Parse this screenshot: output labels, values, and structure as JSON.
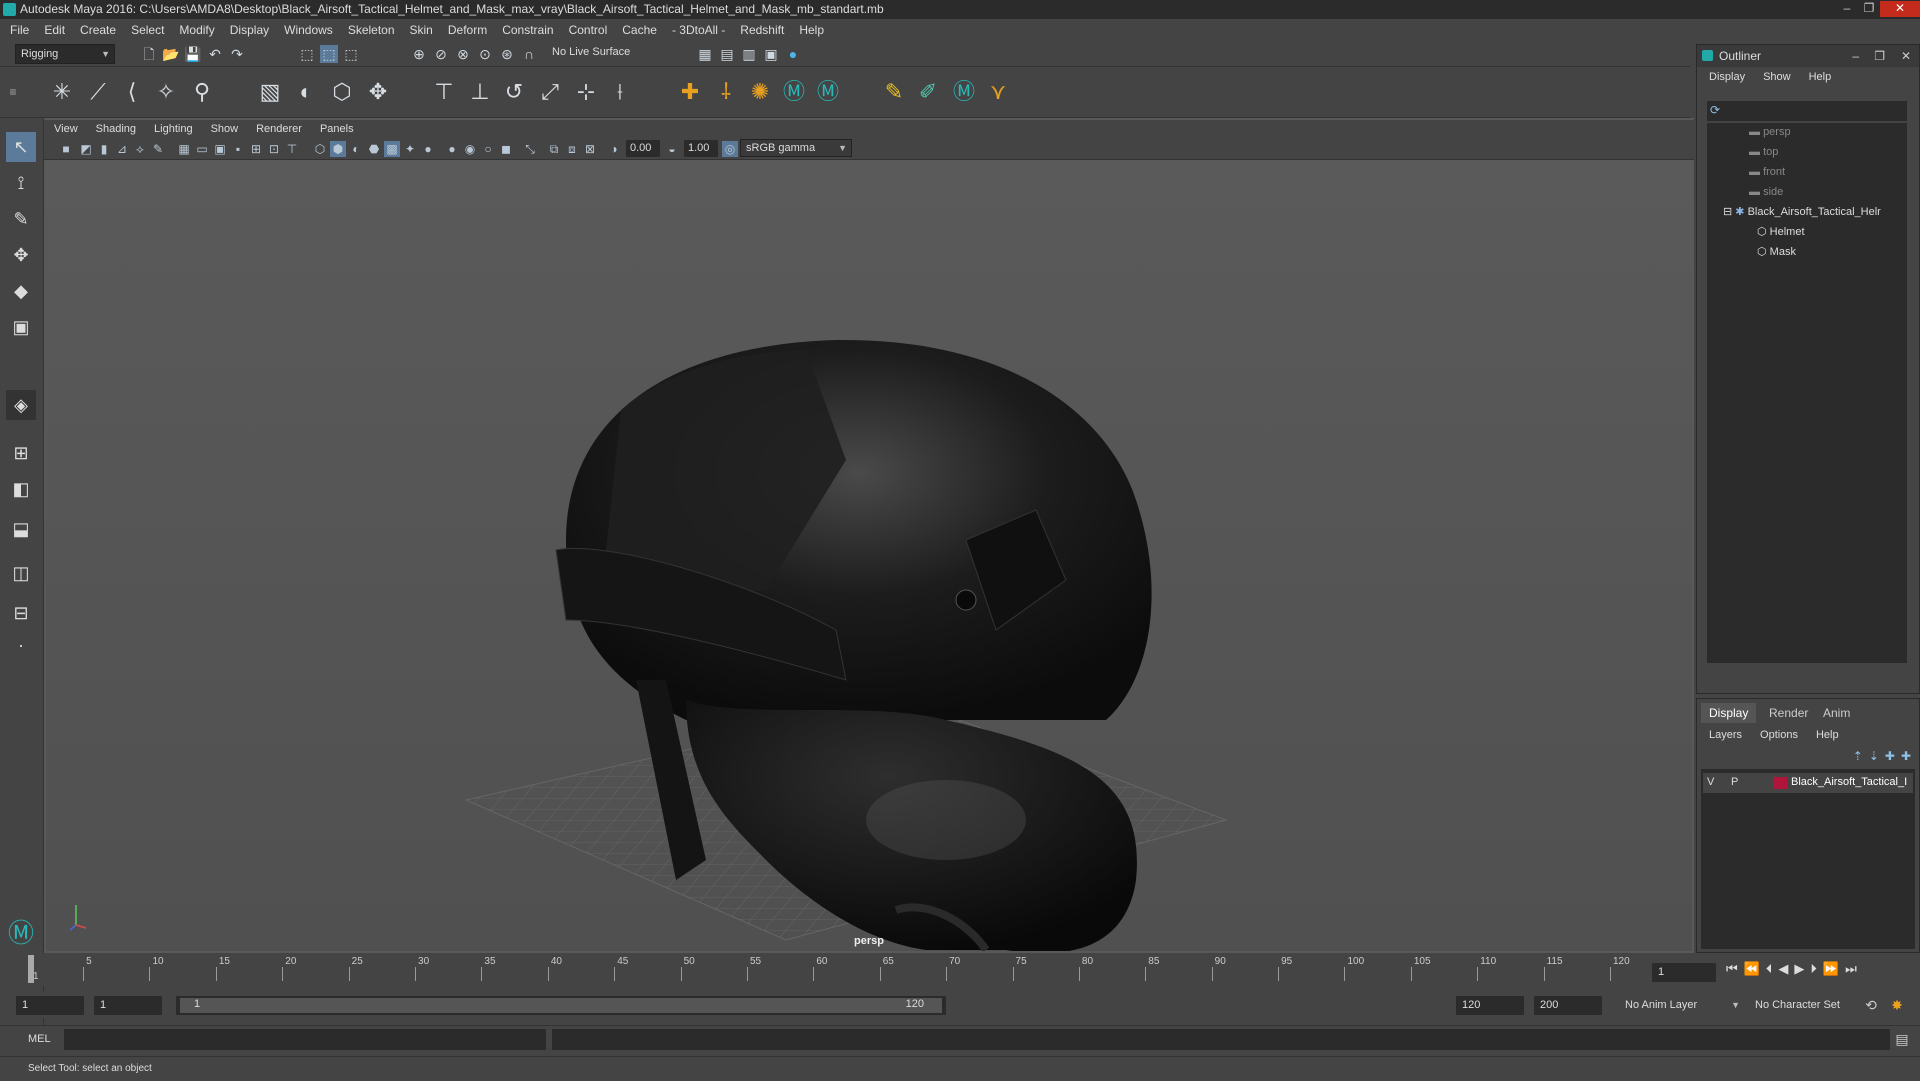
{
  "app": {
    "title": "Autodesk Maya 2016: C:\\Users\\AMDA8\\Desktop\\Black_Airsoft_Tactical_Helmet_and_Mask_max_vray\\Black_Airsoft_Tactical_Helmet_and_Mask_mb_standart.mb"
  },
  "menu": [
    "File",
    "Edit",
    "Create",
    "Select",
    "Modify",
    "Display",
    "Windows",
    "Skeleton",
    "Skin",
    "Deform",
    "Constrain",
    "Control",
    "Cache",
    "- 3DtoAll -",
    "Redshift",
    "Help"
  ],
  "status": {
    "mode": "Rigging",
    "live_surface": "No Live Surface"
  },
  "panel": {
    "menu": [
      "View",
      "Shading",
      "Lighting",
      "Show",
      "Renderer",
      "Panels"
    ],
    "exposure": "0.00",
    "gamma": "1.00",
    "color_space": "sRGB gamma",
    "camera": "persp"
  },
  "outliner": {
    "title": "Outliner",
    "menu": [
      "Display",
      "Show",
      "Help"
    ],
    "items": [
      {
        "label": "persp",
        "dim": true,
        "depth": 0
      },
      {
        "label": "top",
        "dim": true,
        "depth": 0
      },
      {
        "label": "front",
        "dim": true,
        "depth": 0
      },
      {
        "label": "side",
        "dim": true,
        "depth": 0
      },
      {
        "label": "Black_Airsoft_Tactical_Helr",
        "dim": false,
        "depth": 0
      },
      {
        "label": "Helmet",
        "dim": false,
        "depth": 1
      },
      {
        "label": "Mask",
        "dim": false,
        "depth": 1
      }
    ]
  },
  "layers": {
    "tabs": [
      "Display",
      "Render",
      "Anim"
    ],
    "menu": [
      "Layers",
      "Options",
      "Help"
    ],
    "layer": {
      "v": "V",
      "p": "P",
      "name": "Black_Airsoft_Tactical_I",
      "color": "#b0143a"
    }
  },
  "timeline": {
    "ticks": [
      "1",
      "5",
      "10",
      "15",
      "20",
      "25",
      "30",
      "35",
      "40",
      "45",
      "50",
      "55",
      "60",
      "65",
      "70",
      "75",
      "80",
      "85",
      "90",
      "95",
      "100",
      "105",
      "110",
      "115",
      "120"
    ],
    "current_frame": "1"
  },
  "range": {
    "start": "1",
    "start2": "1",
    "slider_start": "1",
    "slider_end": "120",
    "end": "120",
    "max": "200",
    "anim_layer": "No Anim Layer",
    "char_set": "No Character Set"
  },
  "cmd": {
    "label": "MEL"
  },
  "help": {
    "text": "Select Tool: select an object"
  }
}
